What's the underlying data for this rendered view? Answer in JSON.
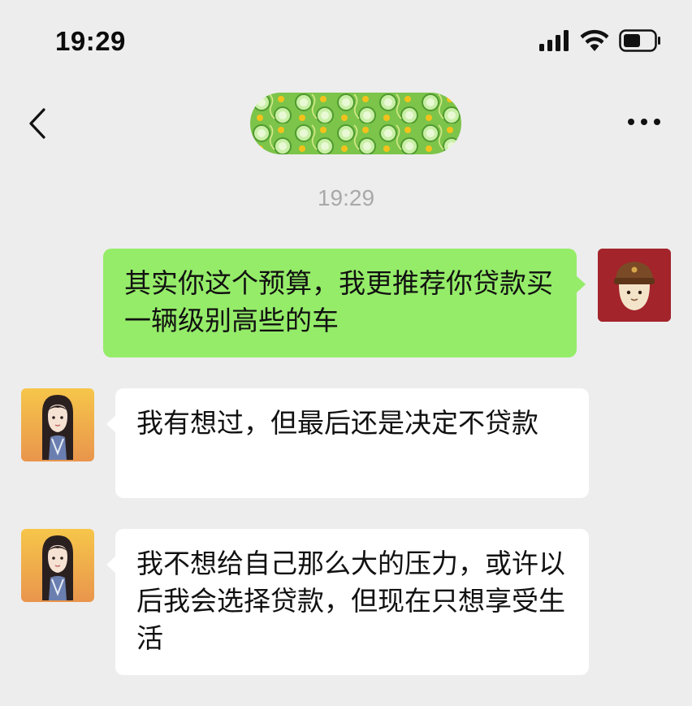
{
  "status_bar": {
    "time": "19:29",
    "icons": [
      "cellular-signal-icon",
      "wifi-icon",
      "battery-icon"
    ]
  },
  "nav": {
    "back_icon": "chevron-left-icon",
    "more_icon": "more-dots-icon"
  },
  "chat": {
    "timestamp": "19:29",
    "messages": [
      {
        "direction": "sent",
        "text": "其实你这个预算，我更推荐你贷款买一辆级别高些的车"
      },
      {
        "direction": "received",
        "text": "我有想过，但最后还是决定不贷款"
      },
      {
        "direction": "received",
        "text": "我不想给自己那么大的压力，或许以后我会选择贷款，但现在只想享受生活"
      }
    ]
  },
  "colors": {
    "background": "#ededed",
    "sent_bubble": "#95ec69",
    "received_bubble": "#ffffff",
    "timestamp_text": "#a9a9a9"
  }
}
